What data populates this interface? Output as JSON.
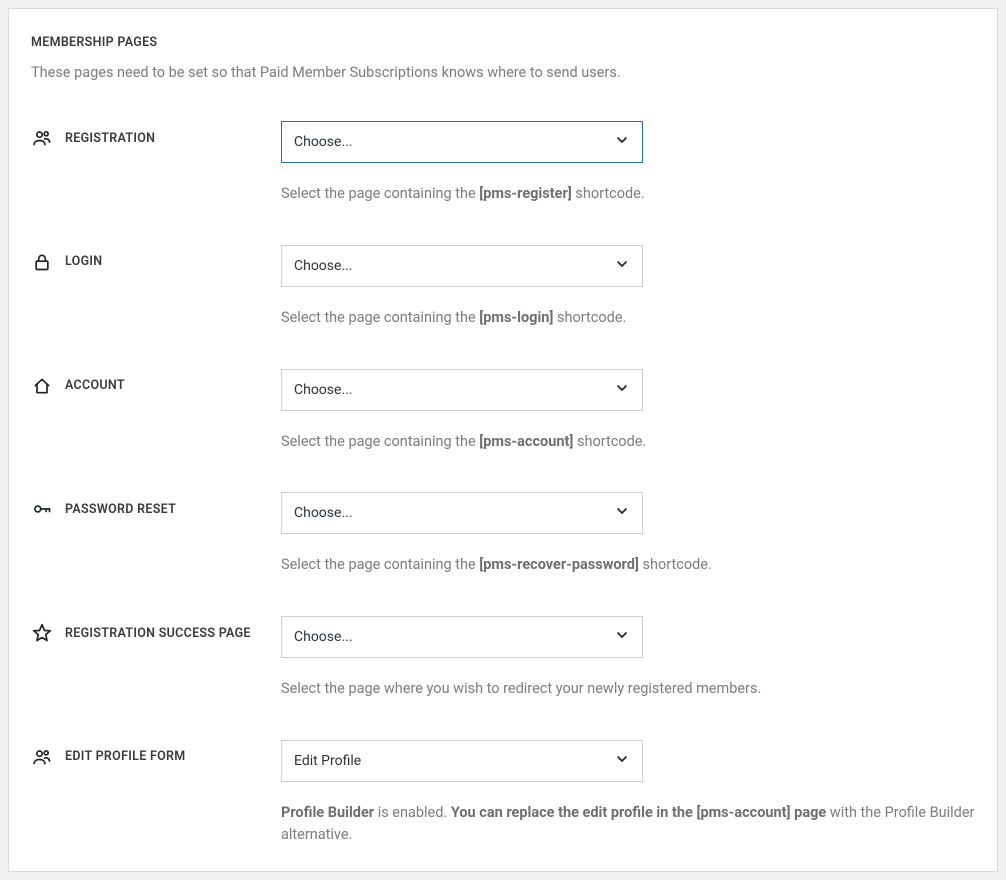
{
  "panel": {
    "title": "MEMBERSHIP PAGES",
    "description": "These pages need to be set so that Paid Member Subscriptions knows where to send users."
  },
  "fields": {
    "registration": {
      "label": "REGISTRATION",
      "value": "Choose...",
      "help_pre": "Select the page containing the ",
      "help_code": "[pms-register]",
      "help_post": " shortcode."
    },
    "login": {
      "label": "LOGIN",
      "value": "Choose...",
      "help_pre": "Select the page containing the ",
      "help_code": "[pms-login]",
      "help_post": " shortcode."
    },
    "account": {
      "label": "ACCOUNT",
      "value": "Choose...",
      "help_pre": "Select the page containing the ",
      "help_code": "[pms-account]",
      "help_post": " shortcode."
    },
    "password_reset": {
      "label": "PASSWORD RESET",
      "value": "Choose...",
      "help_pre": "Select the page containing the ",
      "help_code": "[pms-recover-password]",
      "help_post": " shortcode."
    },
    "registration_success": {
      "label": "REGISTRATION SUCCESS PAGE",
      "value": "Choose...",
      "help": "Select the page where you wish to redirect your newly registered members."
    },
    "edit_profile": {
      "label": "EDIT PROFILE FORM",
      "value": "Edit Profile",
      "help_pre": "Profile Builder",
      "help_mid": " is enabled. ",
      "help_bold": "You can replace the edit profile in the [pms-account] page",
      "help_post": " with the Profile Builder alternative."
    }
  }
}
